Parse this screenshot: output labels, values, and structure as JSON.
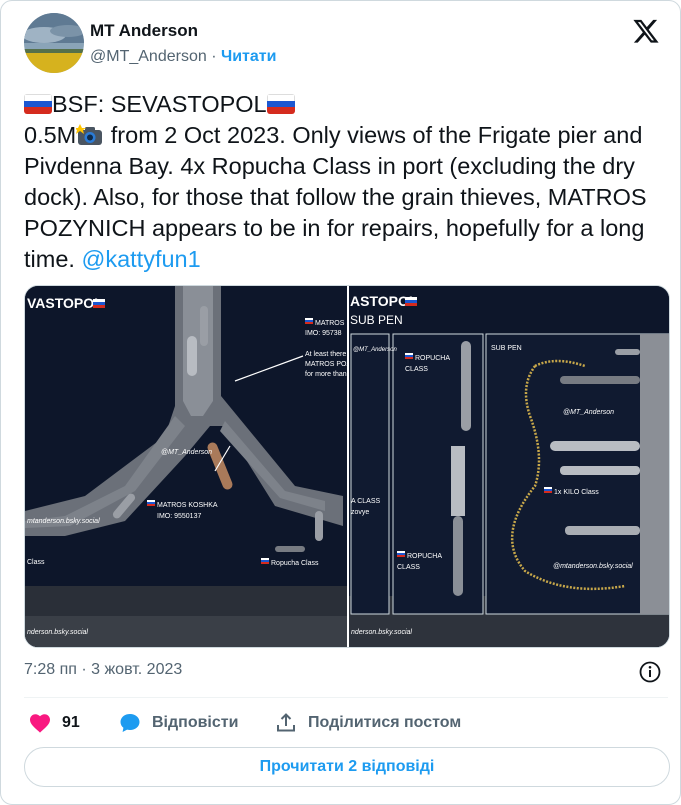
{
  "author": {
    "name": "MT Anderson",
    "handle": "@MT_Anderson",
    "separator": "·",
    "follow_label": "Читати"
  },
  "tweet": {
    "line1_text": "BSF: SEVASTOPOL",
    "line2_prefix": "0.5M",
    "body_after_icon": " from 2 Oct 2023. Only views of the Frigate pier and Pivdenna Bay. 4x Ropucha Class in port (excluding the dry dock). Also, for those that follow the grain thieves, MATROS POZYNICH appears to be in for repairs, hopefully for a long time. ",
    "mention": "@kattyfun1",
    "emoji": [
      "russia-flag",
      "camera-flash",
      "russia-flag"
    ]
  },
  "media": {
    "left_image": {
      "title": "VASTOPOL",
      "labels": {
        "matros_top": "MATROS",
        "imo_top": "IMO: 95738",
        "note_line1": "At least there",
        "note_line2": "MATROS POZ",
        "note_line3": "for more than",
        "watermark_handle": "@MT_Anderson",
        "koshka_name": "MATROS KOSHKA",
        "koshka_imo": "IMO: 9550137",
        "bsky": "mtanderson.bsky.social",
        "class_left": "Class",
        "ropucha": "Ropucha Class",
        "bottom_bsky": "nderson.bsky.social"
      }
    },
    "right_image": {
      "title": "ASTOPOL",
      "subtitle": "SUB PEN",
      "labels": {
        "anderson_top": "@MT_Anderson",
        "ropucha_top_1": "ROPUCHA",
        "ropucha_top_2": "CLASS",
        "sub_pen": "SUB PEN",
        "watermark_handle": "@MT_Anderson",
        "class_a": "A CLASS",
        "class_b": "zovye",
        "kilo": "1x KILO Class",
        "ropucha_bot_1": "ROPUCHA",
        "ropucha_bot_2": "CLASS",
        "bsky": "@mtanderson.bsky.social",
        "bottom_bsky": "nderson.bsky.social"
      }
    }
  },
  "meta": {
    "timestamp": "7:28 пп · 3 жовт. 2023"
  },
  "actions": {
    "likes": "91",
    "reply_label": "Відповісти",
    "share_label": "Поділитися постом"
  },
  "read_replies_label": "Прочитати 2 відповіді",
  "colors": {
    "accent": "#1d9bf0",
    "like": "#f91880",
    "secondary_text": "#536471",
    "border": "#cfd9de"
  }
}
